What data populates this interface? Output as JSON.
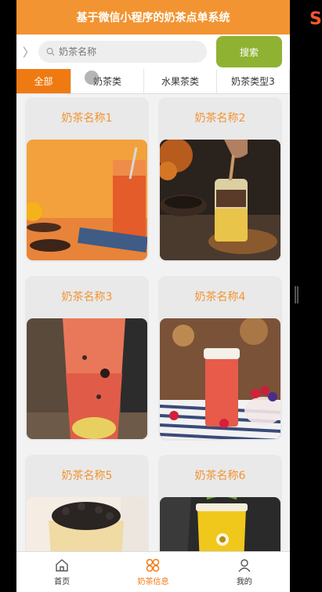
{
  "header": {
    "title": "基于微信小程序的奶茶点单系统"
  },
  "search": {
    "placeholder": "奶茶名称",
    "button_label": "搜索"
  },
  "tabs": [
    {
      "label": "全部",
      "active": true
    },
    {
      "label": "奶茶类",
      "active": false
    },
    {
      "label": "水果茶类",
      "active": false
    },
    {
      "label": "奶茶类型3",
      "active": false
    }
  ],
  "products": [
    {
      "name": "奶茶名称1"
    },
    {
      "name": "奶茶名称2"
    },
    {
      "name": "奶茶名称3"
    },
    {
      "name": "奶茶名称4"
    },
    {
      "name": "奶茶名称5"
    },
    {
      "name": "奶茶名称6"
    }
  ],
  "tabbar": [
    {
      "label": "首页",
      "icon": "home-icon",
      "active": false
    },
    {
      "label": "奶茶信息",
      "icon": "grid-icon",
      "active": true
    },
    {
      "label": "我的",
      "icon": "user-icon",
      "active": false
    }
  ],
  "colors": {
    "accent": "#f29431",
    "active_tab": "#f07a12",
    "search_button": "#8fb233"
  }
}
